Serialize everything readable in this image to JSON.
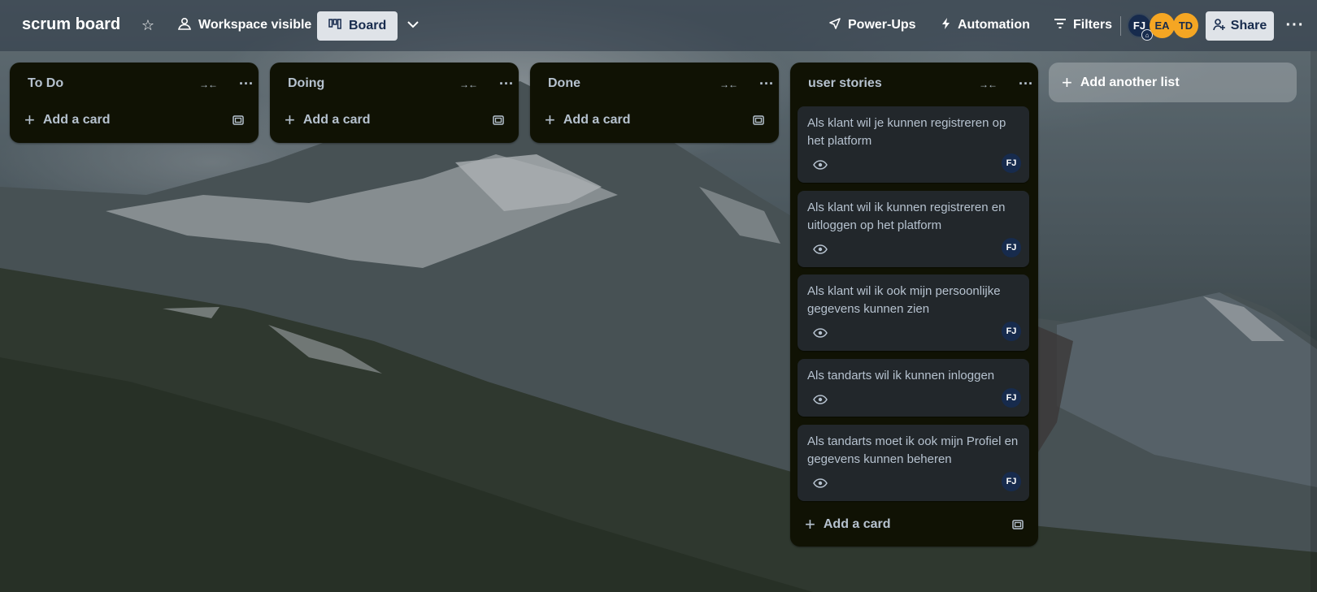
{
  "header": {
    "board_title": "scrum board",
    "visibility_label": "Workspace visible",
    "view_label": "Board",
    "powerups_label": "Power-Ups",
    "automation_label": "Automation",
    "filters_label": "Filters",
    "share_label": "Share",
    "members": [
      "FJ",
      "EA",
      "TD"
    ]
  },
  "lists": [
    {
      "title": "To Do",
      "add_card_label": "Add a card"
    },
    {
      "title": "Doing",
      "add_card_label": "Add a card"
    },
    {
      "title": "Done",
      "add_card_label": "Add a card"
    },
    {
      "title": "user stories",
      "add_card_label": "Add a card",
      "cards": [
        {
          "title": "Als klant wil je kunnen registreren op het platform",
          "member": "FJ"
        },
        {
          "title": "Als klant wil ik kunnen registreren en uitloggen op het platform",
          "member": "FJ"
        },
        {
          "title": "Als klant wil ik ook mijn persoonlijke gegevens kunnen zien",
          "member": "FJ"
        },
        {
          "title": "Als tandarts wil ik kunnen inloggen",
          "member": "FJ"
        },
        {
          "title": "Als tandarts moet ik ook mijn Profiel en gegevens kunnen beheren",
          "member": "FJ"
        }
      ]
    }
  ],
  "add_list_label": "Add another list",
  "icons": {
    "star": "star-icon",
    "visibility": "people-icon",
    "board": "board-icon",
    "chevron": "chevron-down-icon",
    "powerups": "rocket-icon",
    "automation": "bolt-icon",
    "filters": "filter-icon",
    "share": "add-person-icon",
    "collapse": "collapse-icon",
    "more": "ellipsis-icon",
    "template": "template-icon",
    "watch": "eye-icon"
  },
  "colors": {
    "list_bg": "#101204",
    "card_bg": "#22272b",
    "member_avatar": "#172b4d",
    "accent_avatar": "#f5a623"
  }
}
